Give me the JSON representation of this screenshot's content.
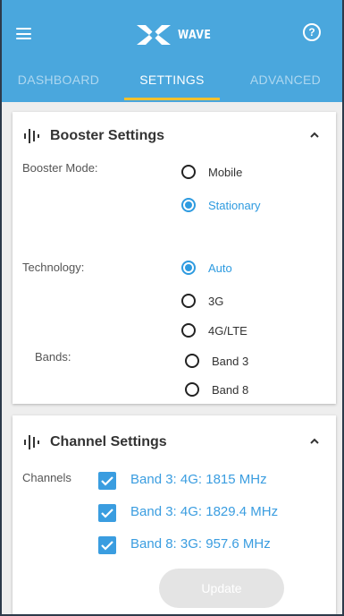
{
  "header": {
    "logo_text": "WAVE",
    "help_icon": "help-circle-icon",
    "menu_icon": "hamburger-menu-icon"
  },
  "tabs": [
    {
      "label": "DASHBOARD",
      "active": false
    },
    {
      "label": "SETTINGS",
      "active": true
    },
    {
      "label": "ADVANCED",
      "active": false
    }
  ],
  "booster": {
    "title": "Booster Settings",
    "mode_label": "Booster Mode:",
    "mode_options": [
      {
        "label": "Mobile",
        "selected": false
      },
      {
        "label": "Stationary",
        "selected": true
      }
    ],
    "technology_label": "Technology:",
    "technology_options": [
      {
        "label": "Auto",
        "selected": true
      },
      {
        "label": "3G",
        "selected": false
      },
      {
        "label": "4G/LTE",
        "selected": false
      }
    ],
    "bands_label": "Bands:",
    "band_options": [
      {
        "label": "Band 3",
        "selected": false
      },
      {
        "label": "Band 8",
        "selected": false
      }
    ]
  },
  "channel": {
    "title": "Channel Settings",
    "channels_label": "Channels",
    "items": [
      {
        "label": "Band 3: 4G: 1815 MHz",
        "checked": true
      },
      {
        "label": "Band 3: 4G: 1829.4 MHz",
        "checked": true
      },
      {
        "label": "Band 8: 3G: 957.6 MHz",
        "checked": true
      }
    ],
    "update_label": "Update"
  },
  "colors": {
    "appbar": "#4aa7dd",
    "tab_indicator": "#f2c12e",
    "accent": "#2e9be0"
  }
}
